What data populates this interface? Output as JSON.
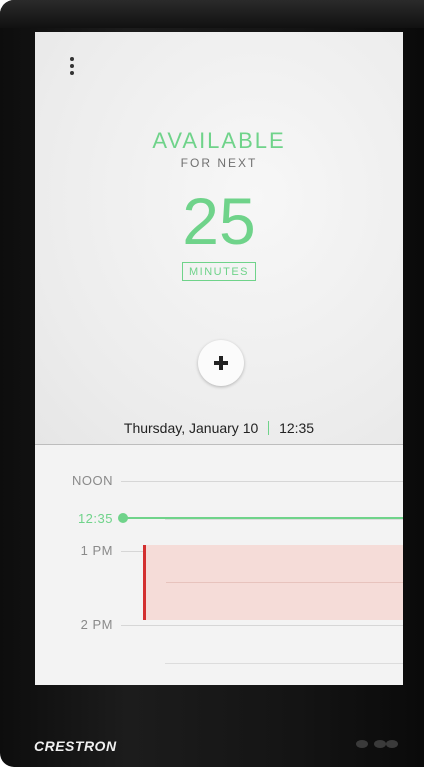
{
  "room": {
    "status": "AVAILABLE",
    "for_next": "FOR NEXT",
    "minutes_value": "25",
    "minutes_label": "MINUTES"
  },
  "datetime": {
    "date_weekday": "Thursday,",
    "date_month_day": "January 10",
    "time": "12:35"
  },
  "schedule": {
    "labels": {
      "noon": "NOON",
      "now": "12:35",
      "one_pm": "1 PM",
      "two_pm": "2 PM"
    }
  },
  "device": {
    "brand": "CRESTRON"
  },
  "icons": {
    "menu": "kebab-menu-icon",
    "add": "plus-icon"
  },
  "colors": {
    "available": "#6fd38a",
    "booking_fill": "#f5dcd8",
    "booking_edge": "#d32f2f"
  }
}
